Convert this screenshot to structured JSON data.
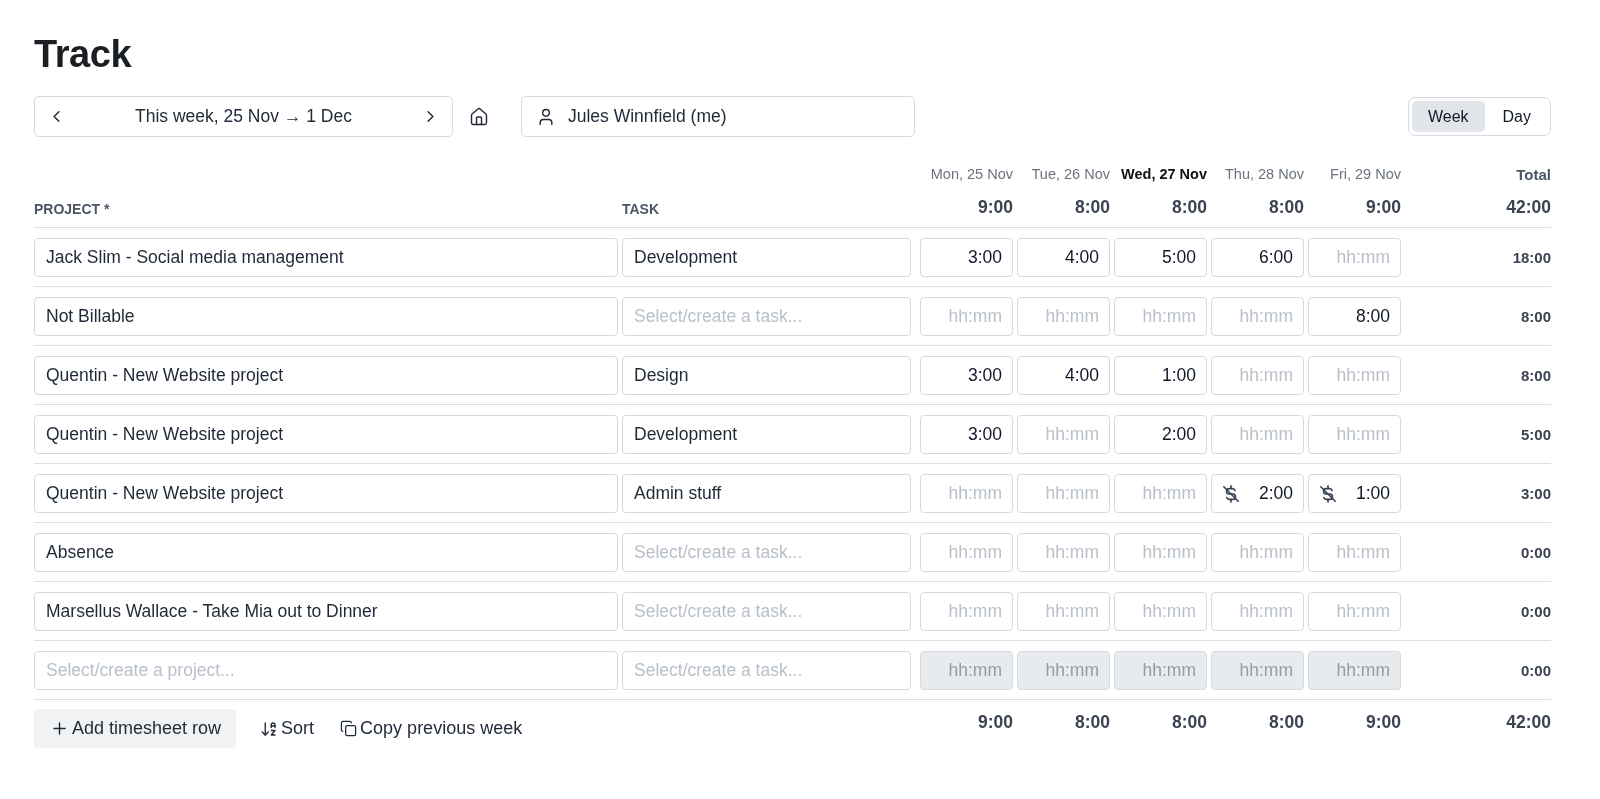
{
  "page": {
    "title": "Track"
  },
  "toolbar": {
    "week_label": "This week, 25 Nov → 1 Dec",
    "user": "Jules Winnfield (me)",
    "views": [
      {
        "label": "Week",
        "selected": true
      },
      {
        "label": "Day",
        "selected": false
      }
    ]
  },
  "columns": {
    "project": "PROJECT *",
    "task": "TASK",
    "total": "Total"
  },
  "days": [
    {
      "label": "Mon, 25 Nov",
      "total": "9:00",
      "today": false
    },
    {
      "label": "Tue, 26 Nov",
      "total": "8:00",
      "today": false
    },
    {
      "label": "Wed, 27 Nov",
      "total": "8:00",
      "today": true
    },
    {
      "label": "Thu, 28 Nov",
      "total": "8:00",
      "today": false
    },
    {
      "label": "Fri, 29 Nov",
      "total": "9:00",
      "today": false
    }
  ],
  "grand_total": "42:00",
  "rows": [
    {
      "project": {
        "value": "Jack Slim - Social media management"
      },
      "task": {
        "value": "Development"
      },
      "entries": [
        {
          "value": "3:00",
          "billable": true,
          "disabled": false
        },
        {
          "value": "4:00",
          "billable": true,
          "disabled": false
        },
        {
          "value": "5:00",
          "billable": true,
          "disabled": false
        },
        {
          "value": "6:00",
          "billable": true,
          "disabled": false
        },
        {
          "placeholder": "hh:mm",
          "billable": true,
          "disabled": false
        }
      ],
      "total": "18:00"
    },
    {
      "project": {
        "value": "Not Billable"
      },
      "task": {
        "placeholder": "Select/create a task..."
      },
      "entries": [
        {
          "placeholder": "hh:mm",
          "billable": true,
          "disabled": false
        },
        {
          "placeholder": "hh:mm",
          "billable": true,
          "disabled": false
        },
        {
          "placeholder": "hh:mm",
          "billable": true,
          "disabled": false
        },
        {
          "placeholder": "hh:mm",
          "billable": true,
          "disabled": false
        },
        {
          "value": "8:00",
          "billable": true,
          "disabled": false
        }
      ],
      "total": "8:00"
    },
    {
      "project": {
        "value": "Quentin - New Website project"
      },
      "task": {
        "value": "Design"
      },
      "entries": [
        {
          "value": "3:00",
          "billable": true,
          "disabled": false
        },
        {
          "value": "4:00",
          "billable": true,
          "disabled": false
        },
        {
          "value": "1:00",
          "billable": true,
          "disabled": false
        },
        {
          "placeholder": "hh:mm",
          "billable": true,
          "disabled": false
        },
        {
          "placeholder": "hh:mm",
          "billable": true,
          "disabled": false
        }
      ],
      "total": "8:00"
    },
    {
      "project": {
        "value": "Quentin - New Website project"
      },
      "task": {
        "value": "Development"
      },
      "entries": [
        {
          "value": "3:00",
          "billable": true,
          "disabled": false
        },
        {
          "placeholder": "hh:mm",
          "billable": true,
          "disabled": false
        },
        {
          "value": "2:00",
          "billable": true,
          "disabled": false
        },
        {
          "placeholder": "hh:mm",
          "billable": true,
          "disabled": false
        },
        {
          "placeholder": "hh:mm",
          "billable": true,
          "disabled": false
        }
      ],
      "total": "5:00"
    },
    {
      "project": {
        "value": "Quentin - New Website project"
      },
      "task": {
        "value": "Admin stuff"
      },
      "entries": [
        {
          "placeholder": "hh:mm",
          "billable": true,
          "disabled": false
        },
        {
          "placeholder": "hh:mm",
          "billable": true,
          "disabled": false
        },
        {
          "placeholder": "hh:mm",
          "billable": true,
          "disabled": false
        },
        {
          "value": "2:00",
          "billable": false,
          "disabled": false
        },
        {
          "value": "1:00",
          "billable": false,
          "disabled": false
        }
      ],
      "total": "3:00"
    },
    {
      "project": {
        "value": "Absence"
      },
      "task": {
        "placeholder": "Select/create a task..."
      },
      "entries": [
        {
          "placeholder": "hh:mm",
          "billable": true,
          "disabled": false
        },
        {
          "placeholder": "hh:mm",
          "billable": true,
          "disabled": false
        },
        {
          "placeholder": "hh:mm",
          "billable": true,
          "disabled": false
        },
        {
          "placeholder": "hh:mm",
          "billable": true,
          "disabled": false
        },
        {
          "placeholder": "hh:mm",
          "billable": true,
          "disabled": false
        }
      ],
      "total": "0:00"
    },
    {
      "project": {
        "value": "Marsellus Wallace - Take Mia out to Dinner"
      },
      "task": {
        "placeholder": "Select/create a task..."
      },
      "entries": [
        {
          "placeholder": "hh:mm",
          "billable": true,
          "disabled": false
        },
        {
          "placeholder": "hh:mm",
          "billable": true,
          "disabled": false
        },
        {
          "placeholder": "hh:mm",
          "billable": true,
          "disabled": false
        },
        {
          "placeholder": "hh:mm",
          "billable": true,
          "disabled": false
        },
        {
          "placeholder": "hh:mm",
          "billable": true,
          "disabled": false
        }
      ],
      "total": "0:00"
    },
    {
      "project": {
        "placeholder": "Select/create a project..."
      },
      "task": {
        "placeholder": "Select/create a task..."
      },
      "entries": [
        {
          "placeholder": "hh:mm",
          "billable": true,
          "disabled": true
        },
        {
          "placeholder": "hh:mm",
          "billable": true,
          "disabled": true
        },
        {
          "placeholder": "hh:mm",
          "billable": true,
          "disabled": true
        },
        {
          "placeholder": "hh:mm",
          "billable": true,
          "disabled": true
        },
        {
          "placeholder": "hh:mm",
          "billable": true,
          "disabled": true
        }
      ],
      "total": "0:00"
    }
  ],
  "actions": [
    {
      "kind": "add",
      "label": "Add timesheet row"
    },
    {
      "kind": "sort",
      "label": "Sort"
    },
    {
      "kind": "copy",
      "label": "Copy previous week"
    }
  ],
  "footer_totals": {
    "days": [
      "9:00",
      "8:00",
      "8:00",
      "8:00",
      "9:00"
    ],
    "total": "42:00"
  }
}
